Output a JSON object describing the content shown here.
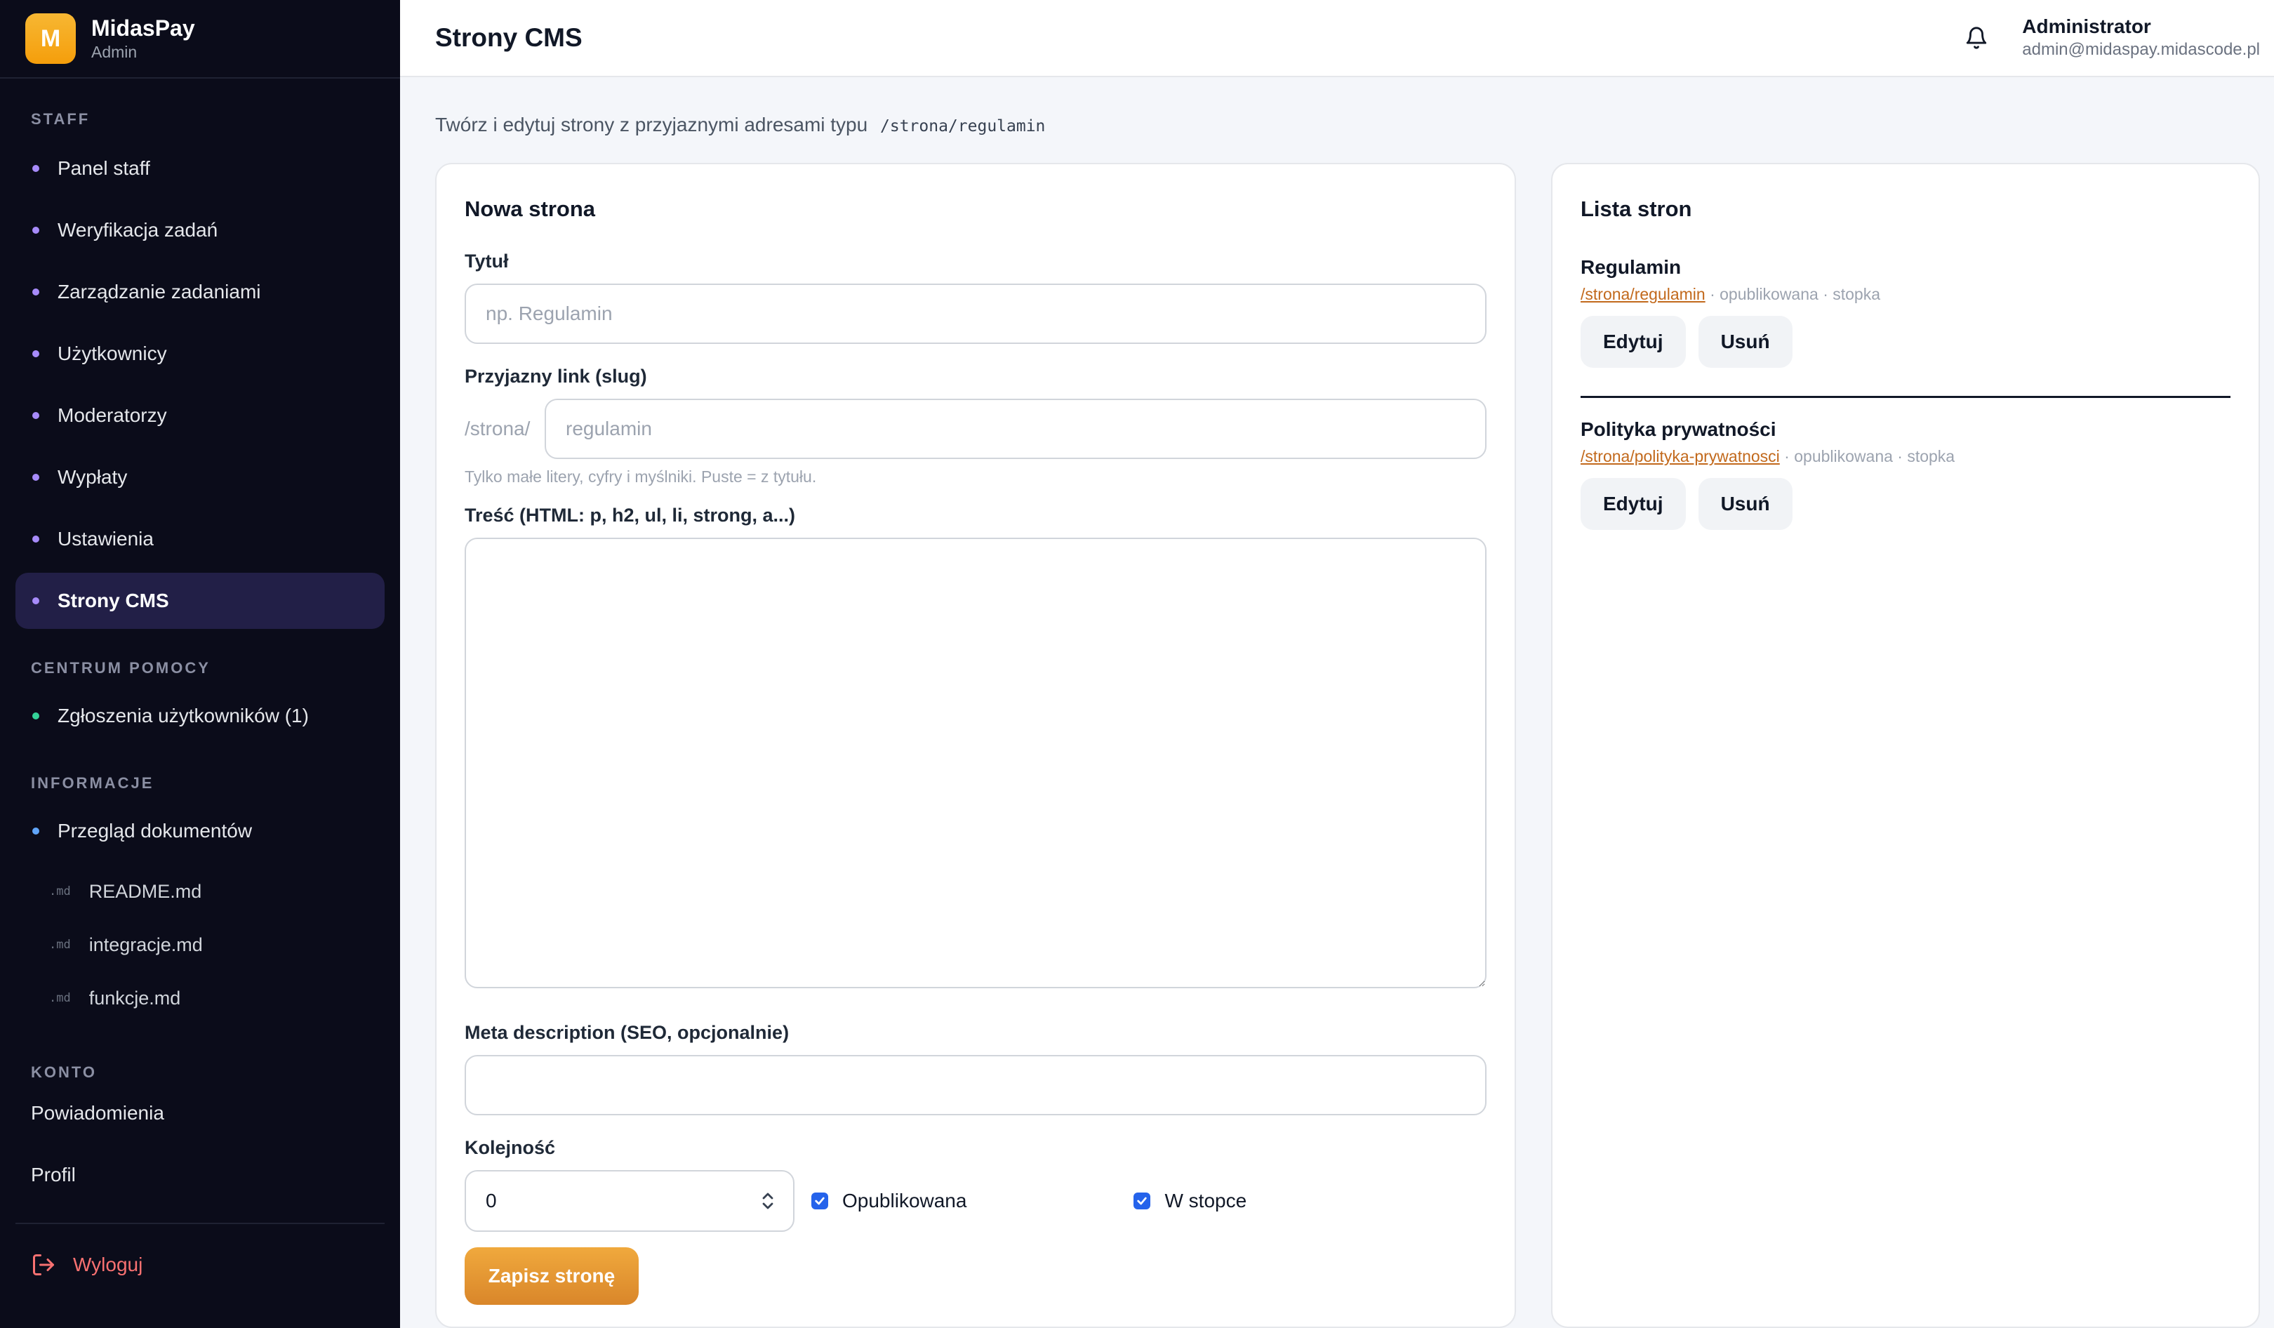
{
  "brand": {
    "logo_letter": "M",
    "name": "MidasPay",
    "subtitle": "Admin"
  },
  "sidebar": {
    "staff_title": "STAFF",
    "staff_items": [
      {
        "label": "Panel staff"
      },
      {
        "label": "Weryfikacja zadań"
      },
      {
        "label": "Zarządzanie zadaniami"
      },
      {
        "label": "Użytkownicy"
      },
      {
        "label": "Moderatorzy"
      },
      {
        "label": "Wypłaty"
      },
      {
        "label": "Ustawienia"
      },
      {
        "label": "Strony CMS",
        "active": true
      }
    ],
    "help_title": "CENTRUM POMOCY",
    "help_items": [
      {
        "label": "Zgłoszenia użytkowników (1)"
      }
    ],
    "info_title": "INFORMACJE",
    "info_items": [
      {
        "label": "Przegląd dokumentów"
      }
    ],
    "docs": [
      {
        "ext": ".md",
        "label": "README.md"
      },
      {
        "ext": ".md",
        "label": "integracje.md"
      },
      {
        "ext": ".md",
        "label": "funkcje.md"
      }
    ],
    "account_title": "KONTO",
    "account_items": [
      {
        "label": "Powiadomienia"
      },
      {
        "label": "Profil"
      }
    ],
    "logout_label": "Wyloguj"
  },
  "header": {
    "title": "Strony CMS",
    "user_name": "Administrator",
    "user_email": "admin@midaspay.midascode.pl"
  },
  "intro": {
    "text": "Twórz i edytuj strony z przyjaznymi adresami typu",
    "example_path": "/strona/regulamin"
  },
  "form": {
    "title": "Nowa strona",
    "title_label": "Tytuł",
    "title_placeholder": "np. Regulamin",
    "title_value": "",
    "slug_label": "Przyjazny link (slug)",
    "slug_prefix": "/strona/",
    "slug_placeholder": "regulamin",
    "slug_hint": "Tylko małe litery, cyfry i myślniki. Puste = z tytułu.",
    "content_label": "Treść (HTML: p, h2, ul, li, strong, a...)",
    "content_value": "",
    "meta_label": "Meta description (SEO, opcjonalnie)",
    "meta_value": "",
    "order_label": "Kolejność",
    "order_value": "0",
    "published_label": "Opublikowana",
    "published_checked": true,
    "footer_label": "W stopce",
    "footer_checked": true,
    "save_label": "Zapisz stronę"
  },
  "list": {
    "title": "Lista stron",
    "items": [
      {
        "title": "Regulamin",
        "slug": "/strona/regulamin",
        "meta": " · opublikowana · stopka",
        "edit_label": "Edytuj",
        "delete_label": "Usuń"
      },
      {
        "title": "Polityka prywatności",
        "slug": "/strona/polityka-prywatnosci",
        "meta": " · opublikowana · stopka",
        "edit_label": "Edytuj",
        "delete_label": "Usuń"
      }
    ]
  },
  "colors": {
    "sidebar_bg": "#0b0c1a",
    "accent_orange": "#e59633",
    "active_nav_bg": "#221f47",
    "checkbox_blue": "#2563eb",
    "logout_red": "#f87171"
  }
}
